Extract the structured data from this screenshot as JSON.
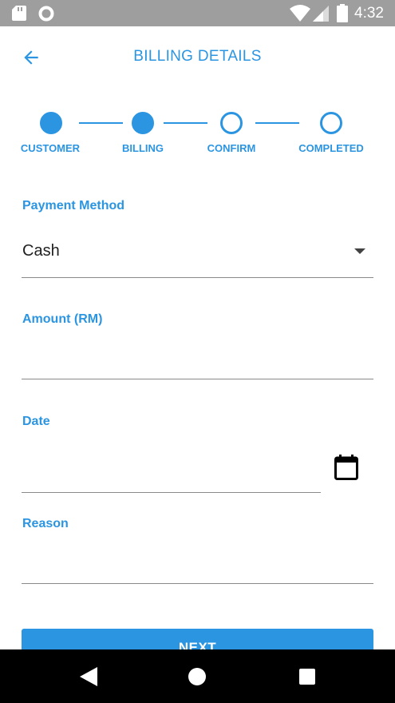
{
  "status_bar": {
    "time": "4:32",
    "icons": [
      "sd-card-icon",
      "circle-icon",
      "wifi-icon",
      "signal-icon",
      "battery-icon"
    ],
    "background": "#9e9e9e"
  },
  "header": {
    "title": "BILLING DETAILS",
    "back_icon": "arrow-left-icon"
  },
  "stepper": {
    "steps": [
      {
        "label": "CUSTOMER",
        "state": "completed"
      },
      {
        "label": "BILLING",
        "state": "completed"
      },
      {
        "label": "CONFIRM",
        "state": "pending"
      },
      {
        "label": "COMPLETED",
        "state": "pending"
      }
    ]
  },
  "form": {
    "payment_method": {
      "label": "Payment Method",
      "value": "Cash"
    },
    "amount": {
      "label": "Amount (RM)",
      "value": ""
    },
    "date": {
      "label": "Date",
      "value": "",
      "icon": "calendar-icon"
    },
    "reason": {
      "label": "Reason",
      "value": ""
    }
  },
  "actions": {
    "next_label": "NEXT"
  },
  "nav_bar": {
    "icons": [
      "back-triangle-icon",
      "home-circle-icon",
      "recents-square-icon"
    ]
  },
  "colors": {
    "accent": "#2b95e2",
    "underline": "#8a8a8a",
    "text": "#212121"
  }
}
